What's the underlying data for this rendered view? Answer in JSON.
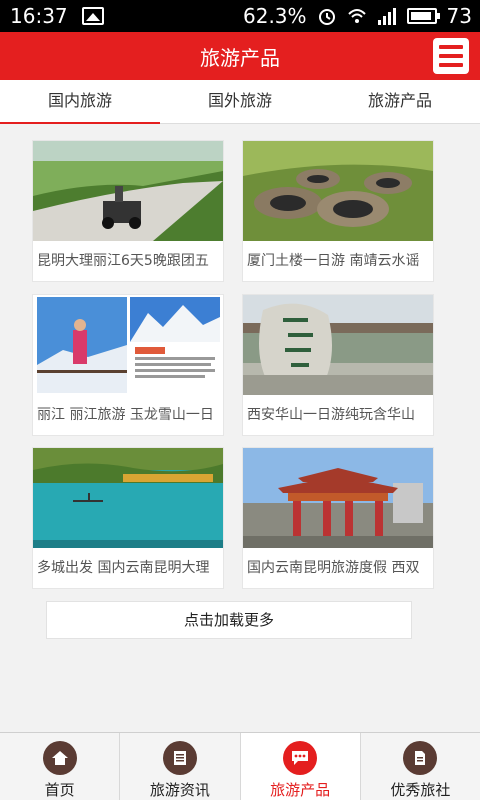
{
  "status_bar": {
    "time": "16:37",
    "battery_pct": "62.3%",
    "signal_value": "73"
  },
  "header": {
    "title": "旅游产品"
  },
  "tabs": [
    {
      "label": "国内旅游",
      "active": true
    },
    {
      "label": "国外旅游",
      "active": false
    },
    {
      "label": "旅游产品",
      "active": false
    }
  ],
  "products": [
    {
      "title": "昆明大理丽江6天5晚跟团五"
    },
    {
      "title": "厦门土楼一日游 南靖云水谣"
    },
    {
      "title": "丽江 丽江旅游 玉龙雪山一日"
    },
    {
      "title": "西安华山一日游纯玩含华山"
    },
    {
      "title": "多城出发 国内云南昆明大理"
    },
    {
      "title": "国内云南昆明旅游度假 西双"
    }
  ],
  "load_more": "点击加载更多",
  "bottom_nav": [
    {
      "label": "首页",
      "icon": "home-icon"
    },
    {
      "label": "旅游资讯",
      "icon": "news-icon"
    },
    {
      "label": "旅游产品",
      "icon": "chat-icon",
      "active": true
    },
    {
      "label": "优秀旅社",
      "icon": "document-icon"
    }
  ],
  "colors": {
    "brand_red": "#e41f1f",
    "nav_icon_brown": "#5a3b33"
  }
}
